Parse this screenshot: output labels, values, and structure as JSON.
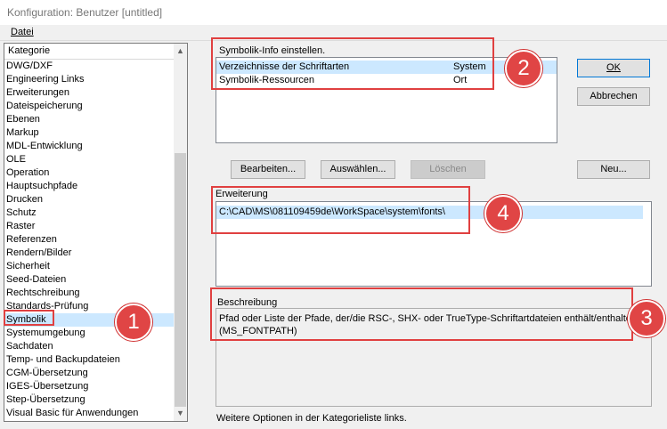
{
  "window": {
    "title": "Konfiguration: Benutzer [untitled]"
  },
  "menu": {
    "datei": "Datei"
  },
  "category": {
    "header": "Kategorie",
    "items": [
      "DWG/DXF",
      "Engineering Links",
      "Erweiterungen",
      "Dateispeicherung",
      "Ebenen",
      "Markup",
      "MDL-Entwicklung",
      "OLE",
      "Operation",
      "Hauptsuchpfade",
      "Drucken",
      "Schutz",
      "Raster",
      "Referenzen",
      "Rendern/Bilder",
      "Sicherheit",
      "Seed-Dateien",
      "Rechtschreibung",
      "Standards-Prüfung",
      "Symbolik",
      "Systemumgebung",
      "Sachdaten",
      "Temp- und Backupdateien",
      "CGM-Übersetzung",
      "IGES-Übersetzung",
      "Step-Übersetzung",
      "Visual Basic für Anwendungen"
    ],
    "selected": "Symbolik"
  },
  "settings": {
    "label": "Symbolik-Info einstellen.",
    "rows": [
      {
        "name": "Verzeichnisse der Schriftarten",
        "value": "System"
      },
      {
        "name": "Symbolik-Ressourcen",
        "value": "Ort"
      }
    ]
  },
  "buttons": {
    "ok": "OK",
    "abbrechen": "Abbrechen",
    "bearbeiten": "Bearbeiten...",
    "auswaehlen": "Auswählen...",
    "loeschen": "Löschen",
    "neu": "Neu..."
  },
  "erweiterung": {
    "label": "Erweiterung",
    "value": "C:\\CAD\\MS\\081109459de\\WorkSpace\\system\\fonts\\"
  },
  "beschreibung": {
    "label": "Beschreibung",
    "line1": "Pfad oder Liste der Pfade, der/die RSC-, SHX- oder TrueType-Schriftartdateien enthält/enthalten.",
    "line2": "(MS_FONTPATH)"
  },
  "footer": "Weitere Optionen in der Kategorieliste links.",
  "callouts": [
    "1",
    "2",
    "3",
    "4"
  ],
  "colors": {
    "callout_red": "#e04040",
    "selection": "#cce8ff"
  }
}
